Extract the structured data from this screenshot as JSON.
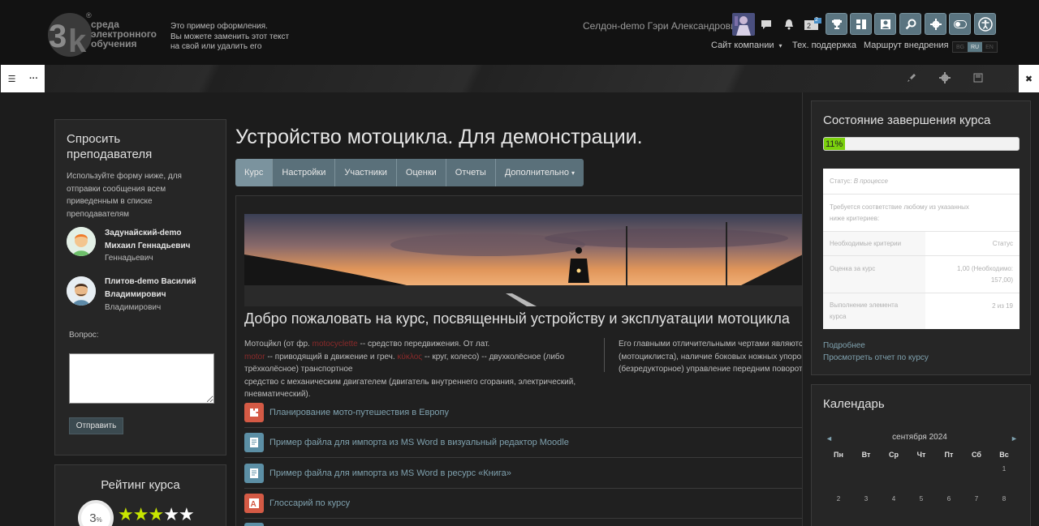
{
  "header": {
    "logo_text": "3k",
    "logo_lines": [
      "среда",
      "электронного",
      "обучения"
    ],
    "logo_reg": "®",
    "tagline_lines": [
      "Это пример оформления.",
      "Вы можете заменить этот текст",
      "на свой или удалить его"
    ],
    "username": "Селдон-demo Гэри Александрович",
    "badge": "2",
    "nav": [
      "Сайт компании",
      "Тех. поддержка",
      "Маршрут внедрения"
    ],
    "languages": [
      "BG",
      "RU",
      "EN"
    ],
    "active_language": "RU"
  },
  "ask_teacher": {
    "title_lines": [
      "Спросить",
      "преподавателя"
    ],
    "description_lines": [
      "Используйте форму ниже, для",
      "отправки сообщения всем",
      "приведенным в списке",
      "преподавателям"
    ],
    "teachers": [
      {
        "name_lines": [
          "Задунайский-demo",
          "Михаил Геннадьевич"
        ],
        "sub": "Геннадьевич"
      },
      {
        "name_lines": [
          "Плитов-demo Василий",
          "Владимирович"
        ],
        "sub": "Владимирович"
      }
    ],
    "question_label": "Вопрос:",
    "send_label": "Отправить"
  },
  "rating": {
    "title": "Рейтинг курса",
    "value": "3",
    "unit": "%",
    "stars_filled": 3,
    "stars_total": 5
  },
  "course": {
    "title": "Устройство мотоцикла. Для демонстрации.",
    "tabs": [
      "Курс",
      "Настройки",
      "Участники",
      "Оценки",
      "Отчеты",
      "Дополнительно"
    ],
    "active_tab": "Курс",
    "welcome": "Добро пожаловать на курс, посвященный устройству и эксплуатации мотоцикла",
    "para_left_lines": [
      [
        "Мотоцйкл (от фр. ",
        "motocyclette",
        " -- средство передвижения. От лат. "
      ],
      [
        "motor",
        " -- приводящий в движение и греч. ",
        "κύκλος",
        " -- круг, колесо) -- двухколёсное (либо трёхколёсное) транспортное"
      ],
      [
        "средство с механическим двигателем (двигатель внутреннего сгорания, электрический,"
      ],
      [
        "пневматический)."
      ]
    ],
    "para_right_lines": [
      "Его главными отличительными чертами являются",
      "(мотоциклиста), наличие боковых ножных упоров",
      "(безредукторное) управление передним поворот"
    ],
    "activities": [
      {
        "label": "Планирование мото-путешествия в Европу",
        "icon": "puzzle-icon",
        "color": "#d45a45"
      },
      {
        "label": "Пример файла для импорта из MS Word в визуальный редактор Moodle",
        "icon": "document-icon",
        "color": "#5c8fa5"
      },
      {
        "label": "Пример файла для импорта из MS Word в ресурс «Книга»",
        "icon": "document-icon",
        "color": "#5c8fa5"
      },
      {
        "label": "Глоссарий по курсу",
        "icon": "glossary-icon",
        "color": "#d45a45"
      }
    ]
  },
  "completion": {
    "title": "Состояние завершения курса",
    "progress_percent": 11,
    "progress_label": "11%",
    "status_label": "Статус:",
    "status_value": "В процессе",
    "requirement_lines": [
      "Требуется соответствие любому из указанных",
      "ниже критериев:"
    ],
    "col_criteria": "Необходимые критерии",
    "col_status": "Статус",
    "rows": [
      {
        "criteria": "Оценка за курс",
        "status_lines": [
          "1,00 (Необходимо:",
          "157,00)"
        ]
      },
      {
        "criteria_lines": [
          "Выполнение элемента",
          "курса"
        ],
        "status_lines": [
          "2 из 19"
        ]
      }
    ],
    "links": [
      "Подробнее",
      "Просмотреть отчет по курсу"
    ]
  },
  "calendar": {
    "title": "Календарь",
    "month": "сентября 2024",
    "days_of_week": [
      "Пн",
      "Вт",
      "Ср",
      "Чт",
      "Пт",
      "Сб",
      "Вс"
    ],
    "week1": [
      "",
      "",
      "",
      "",
      "",
      "",
      "1"
    ],
    "week2": [
      "2",
      "3",
      "4",
      "5",
      "6",
      "7",
      "8"
    ],
    "prev": "◄",
    "next": "►"
  },
  "colors": {
    "accent": "#5a707a",
    "link": "#7fa1ae",
    "progress": "#7bd10c",
    "star": "#c8e600"
  }
}
